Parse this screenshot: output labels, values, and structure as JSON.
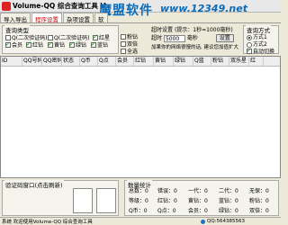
{
  "window": {
    "title": "Volume-QQ 综合查询工具 V",
    "watermark_cn": "魔盟软件",
    "watermark_url": "www.12349.net"
  },
  "tabs": [
    {
      "label": "导入导出"
    },
    {
      "label": "程序设置"
    },
    {
      "label": "杂项设置"
    },
    {
      "label": "软"
    }
  ],
  "filter": {
    "title": "查询类型",
    "options": [
      {
        "label": "Q(二次验证码)",
        "checked": false
      },
      {
        "label": "Q(二次验证码)",
        "checked": false
      },
      {
        "label": "红星",
        "checked": true
      },
      {
        "label": "会员",
        "checked": true
      },
      {
        "label": "红钻",
        "checked": true
      },
      {
        "label": "黄钻",
        "checked": true
      },
      {
        "label": "绿钻",
        "checked": true
      },
      {
        "label": "蓝钻",
        "checked": true
      },
      {
        "label": "粉钻",
        "checked": false
      },
      {
        "label": "双倍",
        "checked": false
      },
      {
        "label": "全选",
        "checked": false
      }
    ]
  },
  "timeout": {
    "label1": "超时设置",
    "hint": "(提示：1秒=1000毫秒)",
    "label2": "超时",
    "value": "5000",
    "unit": "毫秒",
    "set_button": "设置",
    "note": "加果你的网络很慢的话, 建议您加值扩大"
  },
  "method": {
    "title": "查询方式",
    "options": [
      {
        "label": "方式1",
        "selected": true
      },
      {
        "label": "方式2",
        "selected": false
      }
    ],
    "auto_label": "自动切换"
  },
  "grid": {
    "columns": [
      "ID",
      "QQ号码",
      "QQ密码",
      "状态",
      "Q币",
      "Q点",
      "会员",
      "红钻",
      "黄钻",
      "绿钻",
      "Q蓝",
      "粉钻",
      "双乐星",
      "红"
    ]
  },
  "verify": {
    "title": "验证码窗口(点击刷新)"
  },
  "stats": {
    "title": "数量统计",
    "items": [
      {
        "label": "总数：",
        "value": "0"
      },
      {
        "label": "错误：",
        "value": "0"
      },
      {
        "label": "一代：",
        "value": "0"
      },
      {
        "label": "二代：",
        "value": "0"
      },
      {
        "label": "无保：",
        "value": "0"
      },
      {
        "label": "等级：",
        "value": "0"
      },
      {
        "label": "红钻：",
        "value": "0"
      },
      {
        "label": "黄钻：",
        "value": "0"
      },
      {
        "label": "蓝钻：",
        "value": "0"
      },
      {
        "label": "粉钻：",
        "value": "0"
      },
      {
        "label": "Q币：",
        "value": "0"
      },
      {
        "label": "Q点：",
        "value": "0"
      },
      {
        "label": "会员：",
        "value": "0"
      },
      {
        "label": "绿钻：",
        "value": "0"
      },
      {
        "label": "双倍：",
        "value": "0"
      }
    ]
  },
  "status": {
    "left": "系统 欢迎使用Volume-QQ 综合查询工具",
    "right": "QQ:564385563"
  }
}
